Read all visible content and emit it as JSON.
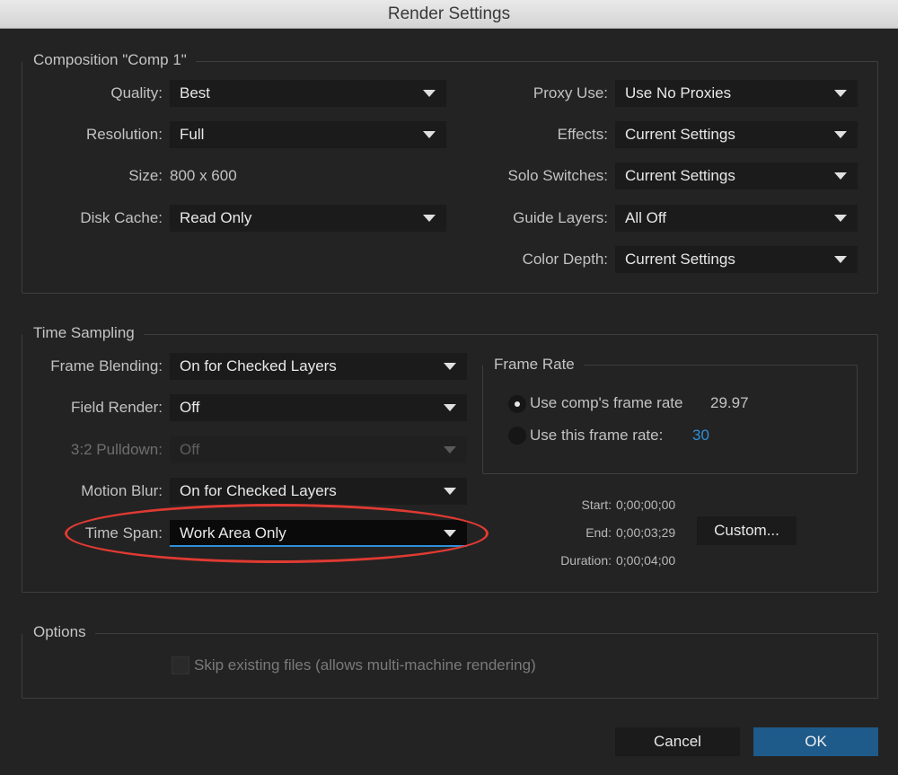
{
  "window": {
    "title": "Render Settings"
  },
  "composition": {
    "title": "Composition \"Comp 1\"",
    "quality": {
      "label": "Quality:",
      "value": "Best"
    },
    "resolution": {
      "label": "Resolution:",
      "value": "Full"
    },
    "size": {
      "label": "Size:",
      "value": "800 x 600"
    },
    "disk_cache": {
      "label": "Disk Cache:",
      "value": "Read Only"
    },
    "proxy_use": {
      "label": "Proxy Use:",
      "value": "Use No Proxies"
    },
    "effects": {
      "label": "Effects:",
      "value": "Current Settings"
    },
    "solo_switches": {
      "label": "Solo Switches:",
      "value": "Current Settings"
    },
    "guide_layers": {
      "label": "Guide Layers:",
      "value": "All Off"
    },
    "color_depth": {
      "label": "Color Depth:",
      "value": "Current Settings"
    }
  },
  "time_sampling": {
    "title": "Time Sampling",
    "frame_blending": {
      "label": "Frame Blending:",
      "value": "On for Checked Layers"
    },
    "field_render": {
      "label": "Field Render:",
      "value": "Off"
    },
    "pulldown": {
      "label": "3:2 Pulldown:",
      "value": "Off"
    },
    "motion_blur": {
      "label": "Motion Blur:",
      "value": "On for Checked Layers"
    },
    "time_span": {
      "label": "Time Span:",
      "value": "Work Area Only"
    },
    "frame_rate": {
      "title": "Frame Rate",
      "use_comp_label": "Use comp's frame rate",
      "comp_rate": "29.97",
      "use_this_label": "Use this frame rate:",
      "this_rate": "30",
      "selected": "use_comp"
    },
    "start": {
      "label": "Start:",
      "value": "0;00;00;00"
    },
    "end": {
      "label": "End:",
      "value": "0;00;03;29"
    },
    "duration": {
      "label": "Duration:",
      "value": "0;00;04;00"
    },
    "custom_button": "Custom..."
  },
  "options": {
    "title": "Options",
    "skip_existing_label": "Skip existing files (allows multi-machine rendering)",
    "skip_existing_checked": false
  },
  "buttons": {
    "cancel": "Cancel",
    "ok": "OK"
  },
  "colors": {
    "accent": "#2e8fd8",
    "primary_button": "#1e5a8a",
    "highlight_circle": "#e03a32",
    "frame_rate_value": "#2e8fd8"
  }
}
